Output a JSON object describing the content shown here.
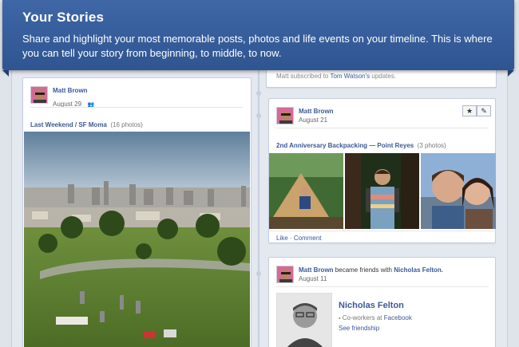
{
  "banner": {
    "title": "Your Stories",
    "text": "Share and highlight your most memorable posts, photos and life events on your timeline. This is where you can tell your story from beginning, to middle, to now."
  },
  "top_story_snippet": {
    "prefix": "Matt subscribed to",
    "name": "Tom Watson's",
    "suffix": "updates."
  },
  "left_post": {
    "author": "Matt Brown",
    "date": "August 29",
    "album_link": "Last Weekend / SF Moma",
    "album_count": "(16 photos)"
  },
  "right_post_1": {
    "author": "Matt Brown",
    "date": "August 21",
    "album_link": "2nd Anniversary Backpacking — Point Reyes",
    "album_count": "(3 photos)",
    "like_label": "Like",
    "dot": "·",
    "comment_label": "Comment"
  },
  "right_post_2": {
    "author": "Matt Brown",
    "action": "became friends with",
    "friend": "Nicholas Felton.",
    "date": "August 11",
    "friend_name": "Nicholas Felton",
    "friend_meta_prefix": "Co-workers at",
    "friend_meta_org": "Facebook",
    "see_friendship": "See friendship"
  },
  "icons": {
    "star": "★",
    "edit": "✎"
  },
  "colors": {
    "banner": "#3563a0",
    "link": "#3b5998",
    "spine": "#c6cfdf"
  }
}
